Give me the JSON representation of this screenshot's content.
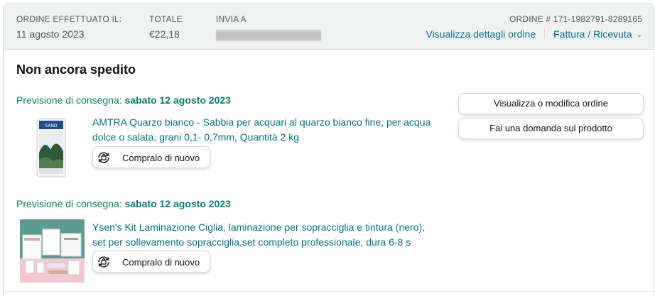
{
  "header": {
    "order_placed_label": "ORDINE EFFETTUATO IL:",
    "order_placed_value": "11 agosto 2023",
    "total_label": "TOTALE",
    "total_value": "€22,18",
    "ship_to_label": "INVIA A",
    "order_number_label": "ORDINE # 171-1982791-8289165",
    "view_details_link": "Visualizza dettagli ordine",
    "invoice_link": "Fattura / Ricevuta",
    "invoice_chevron": "⌄"
  },
  "shipment": {
    "status": "Non ancora spedito",
    "actions": [
      {
        "label": "Visualizza o modifica ordine"
      },
      {
        "label": "Fai una domanda sul prodotto"
      }
    ],
    "items": [
      {
        "delivery_prefix": "Previsione di consegna: ",
        "delivery_date": "sabato 12 agosto 2023",
        "title": "AMTRA Quarzo bianco - Sabbia per acquari al quarzo bianco fine, per acqua dolce o salata, grani 0,1- 0,7mm, Quantità 2 kg",
        "buy_again_label": "Compralo di nuovo",
        "image_icon": "sand-bag-product-image"
      },
      {
        "delivery_prefix": "Previsione di consegna: ",
        "delivery_date": "sabato 12 agosto 2023",
        "title": "Ysen's Kit Laminazione Ciglia, laminazione per sopracciglia e tintura (nero), set per sollevamento sopracciglia,set completo professionale, dura 6-8 s",
        "buy_again_label": "Compralo di nuovo",
        "image_icon": "lash-kit-product-image"
      }
    ]
  },
  "colors": {
    "link": "#007185",
    "delivery_green": "#067d62",
    "header_bg": "#f0f2f2",
    "border": "#d5d9d9"
  }
}
